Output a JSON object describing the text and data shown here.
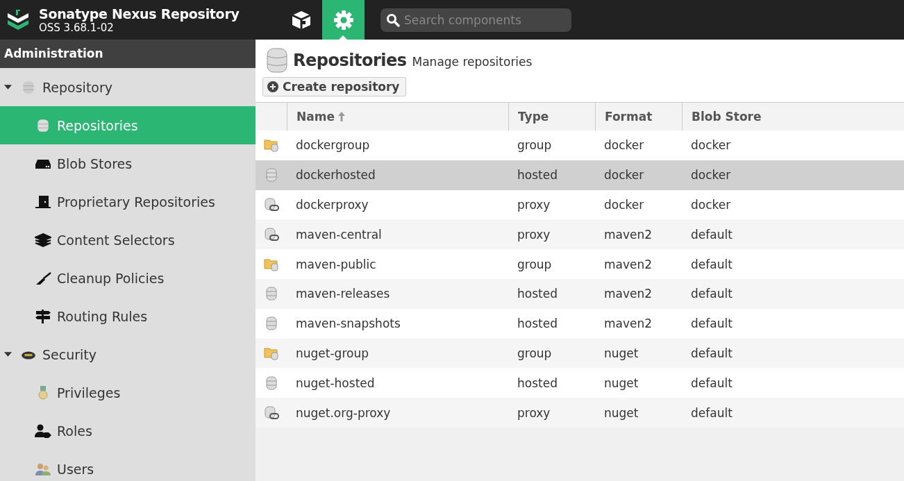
{
  "header": {
    "title": "Sonatype Nexus Repository",
    "version": "OSS 3.68.1-02",
    "search": {
      "placeholder": "Search components"
    },
    "modes": [
      {
        "kind": "browse",
        "selected": false
      },
      {
        "kind": "admin",
        "selected": true
      }
    ]
  },
  "sidebar": {
    "title": "Administration",
    "items": [
      {
        "label": "Repository",
        "kind": "database",
        "expanded": true,
        "selected": false,
        "children": [
          {
            "label": "Repositories",
            "kind": "database",
            "selected": true
          },
          {
            "label": "Blob Stores",
            "kind": "drive",
            "selected": false
          },
          {
            "label": "Proprietary Repositories",
            "kind": "door",
            "selected": false
          },
          {
            "label": "Content Selectors",
            "kind": "layers",
            "selected": false
          },
          {
            "label": "Cleanup Policies",
            "kind": "brush",
            "selected": false
          },
          {
            "label": "Routing Rules",
            "kind": "signpost",
            "selected": false
          }
        ]
      },
      {
        "label": "Security",
        "kind": "cap",
        "expanded": true,
        "selected": false,
        "children": [
          {
            "label": "Privileges",
            "kind": "medal",
            "selected": false
          },
          {
            "label": "Roles",
            "kind": "user-tag",
            "selected": false
          },
          {
            "label": "Users",
            "kind": "users",
            "selected": false
          }
        ]
      }
    ]
  },
  "page": {
    "title": "Repositories",
    "subtitle": "Manage repositories",
    "create_button": "Create repository"
  },
  "table": {
    "columns": [
      {
        "label": "Name",
        "sorted": true
      },
      {
        "label": "Type",
        "sorted": false
      },
      {
        "label": "Format",
        "sorted": false
      },
      {
        "label": "Blob Store",
        "sorted": false
      }
    ],
    "rows": [
      {
        "kind": "group",
        "selected": false,
        "cells": [
          "dockergroup",
          "group",
          "docker",
          "docker"
        ]
      },
      {
        "kind": "hosted",
        "selected": true,
        "cells": [
          "dockerhosted",
          "hosted",
          "docker",
          "docker"
        ]
      },
      {
        "kind": "proxy",
        "selected": false,
        "cells": [
          "dockerproxy",
          "proxy",
          "docker",
          "docker"
        ]
      },
      {
        "kind": "proxy",
        "selected": false,
        "cells": [
          "maven-central",
          "proxy",
          "maven2",
          "default"
        ]
      },
      {
        "kind": "group",
        "selected": false,
        "cells": [
          "maven-public",
          "group",
          "maven2",
          "default"
        ]
      },
      {
        "kind": "hosted",
        "selected": false,
        "cells": [
          "maven-releases",
          "hosted",
          "maven2",
          "default"
        ]
      },
      {
        "kind": "hosted",
        "selected": false,
        "cells": [
          "maven-snapshots",
          "hosted",
          "maven2",
          "default"
        ]
      },
      {
        "kind": "group",
        "selected": false,
        "cells": [
          "nuget-group",
          "group",
          "nuget",
          "default"
        ]
      },
      {
        "kind": "hosted",
        "selected": false,
        "cells": [
          "nuget-hosted",
          "hosted",
          "nuget",
          "default"
        ]
      },
      {
        "kind": "proxy",
        "selected": false,
        "cells": [
          "nuget.org-proxy",
          "proxy",
          "nuget",
          "default"
        ]
      }
    ]
  }
}
